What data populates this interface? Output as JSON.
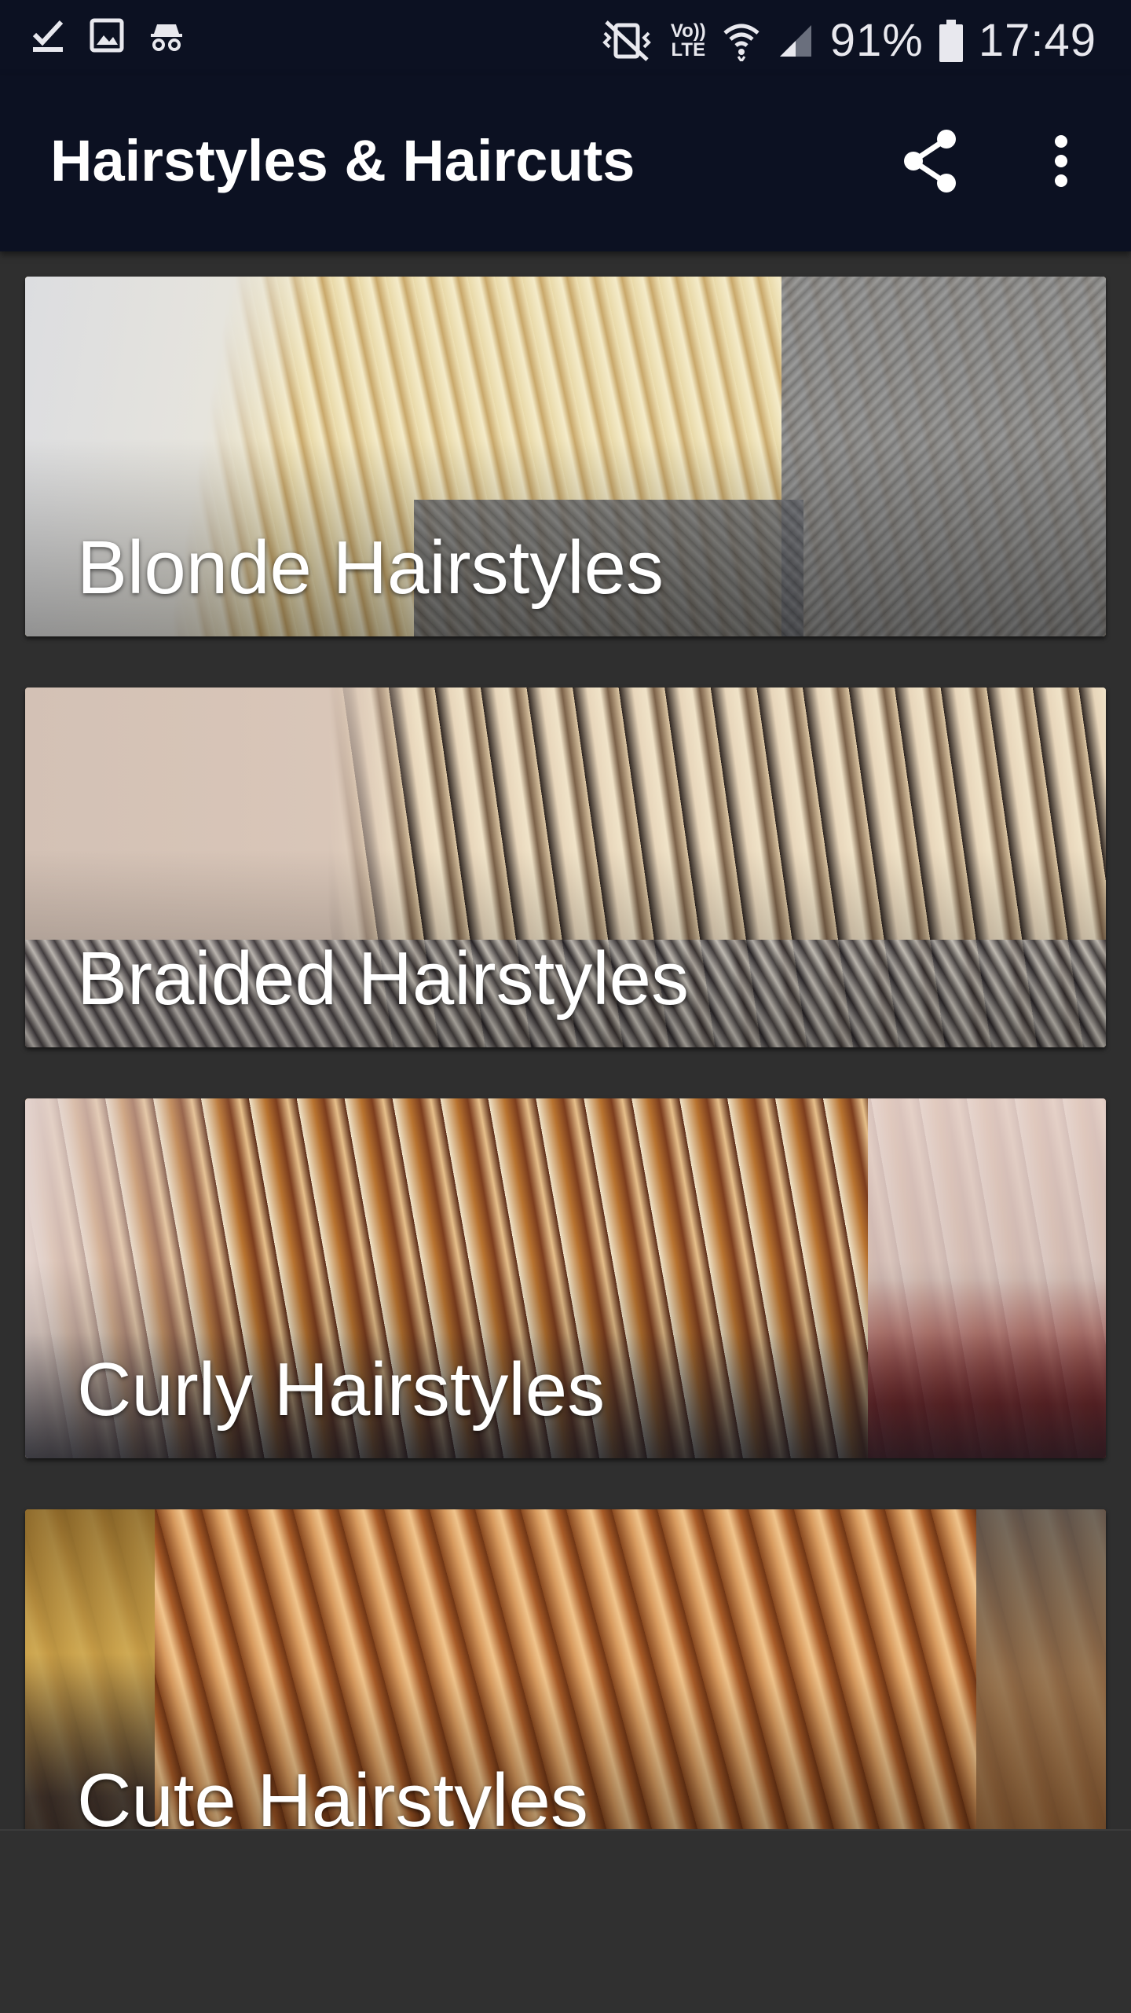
{
  "status_bar": {
    "left_icons": [
      "download-done-icon",
      "image-icon",
      "incognito-icon"
    ],
    "right_icons": [
      "vibrate-mute-icon",
      "volte-icon",
      "wifi-icon",
      "signal-icon",
      "battery-icon"
    ],
    "volte_label_top": "Vo))",
    "volte_label_bottom": "LTE",
    "battery": "91%",
    "time": "17:49"
  },
  "app_bar": {
    "title": "Hairstyles & Haircuts",
    "actions": [
      "share-icon",
      "more-vert-icon"
    ]
  },
  "categories": [
    {
      "label": "Blonde Hairstyles"
    },
    {
      "label": "Braided Hairstyles"
    },
    {
      "label": "Curly Hairstyles"
    },
    {
      "label": "Cute Hairstyles"
    }
  ],
  "colors": {
    "app_bar": "#0c1122",
    "background": "#2f2f2f",
    "text": "#ffffff"
  }
}
